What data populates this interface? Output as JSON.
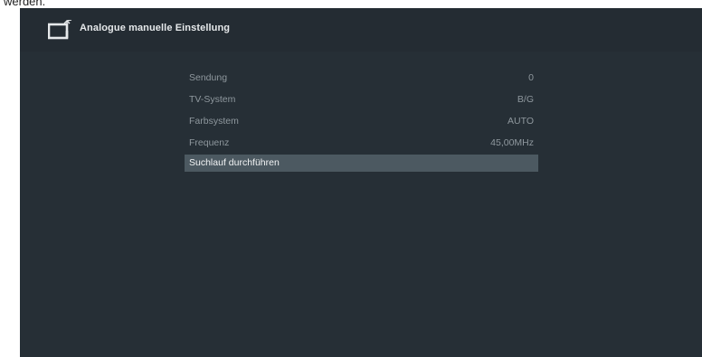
{
  "header": {
    "title": "Analogue manuelle Einstellung",
    "icon": "tv-antenna-icon"
  },
  "menu": {
    "items": [
      {
        "label": "Sendung",
        "value": "0"
      },
      {
        "label": "TV-System",
        "value": "B/G"
      },
      {
        "label": "Farbsystem",
        "value": "AUTO"
      },
      {
        "label": "Frequenz",
        "value": "45,00MHz"
      },
      {
        "label": "Suchlauf durchführen",
        "value": ""
      }
    ]
  },
  "colors": {
    "background": "#262f36",
    "header": "#242c33",
    "selected_row": "#4c5961",
    "text_dim": "#8f989e",
    "text_bright": "#f2f4f5"
  }
}
